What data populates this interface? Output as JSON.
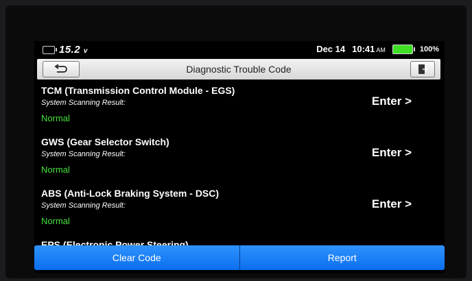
{
  "status_bar": {
    "voltage": "15.2",
    "voltage_unit": "v",
    "date": "Dec 14",
    "time": "10:41",
    "ampm": "AM",
    "battery_percent": "100%",
    "battery_color": "#3fe026"
  },
  "title_bar": {
    "title": "Diagnostic Trouble Code",
    "back_icon": "back-arrow-icon",
    "exit_icon": "exit-door-icon"
  },
  "modules": [
    {
      "name": "TCM (Transmission Control Module - EGS)",
      "subtitle": "System Scanning Result:",
      "status": "Normal",
      "action": "Enter >"
    },
    {
      "name": "GWS (Gear Selector Switch)",
      "subtitle": "System Scanning Result:",
      "status": "Normal",
      "action": "Enter >"
    },
    {
      "name": "ABS (Anti-Lock Braking System - DSC)",
      "subtitle": "System Scanning Result:",
      "status": "Normal",
      "action": "Enter >"
    },
    {
      "name": "EPS (Electronic Power Steering)"
    }
  ],
  "colors": {
    "status_normal": "#45e23a",
    "button_blue": "#1a84ff"
  },
  "bottom_buttons": {
    "clear_code": "Clear Code",
    "report": "Report"
  }
}
